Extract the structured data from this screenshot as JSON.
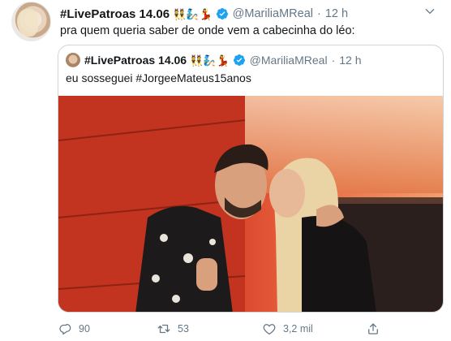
{
  "tweet": {
    "author_name": "#LivePatroas 14.06",
    "author_emoji": "👯🧞💃",
    "handle": "@MariliaMReal",
    "separator": "·",
    "time": "12 h",
    "text": "pra quem queria saber de onde vem a cabecinha do léo:"
  },
  "quote": {
    "author_name": "#LivePatroas 14.06",
    "author_emoji": "👯🧞💃",
    "handle": "@MariliaMReal",
    "separator": "·",
    "time": "12 h",
    "text": "eu sosseguei #JorgeeMateus15anos"
  },
  "actions": {
    "replies": "90",
    "retweets": "53",
    "likes": "3,2 mil"
  },
  "icons": [
    "chevron-down-icon",
    "verified-badge-icon",
    "reply-icon",
    "retweet-icon",
    "like-icon",
    "share-icon"
  ],
  "colors": {
    "verified": "#1da1f2",
    "secondary_text": "#657786",
    "border": "#ccd6dd"
  }
}
